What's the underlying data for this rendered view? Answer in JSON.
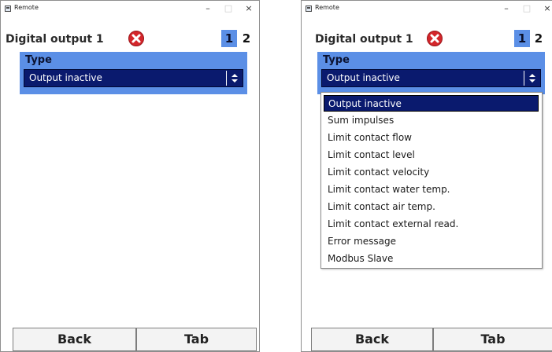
{
  "left": {
    "window_title": "Remote",
    "header": {
      "title": "Digital output 1",
      "tabs": [
        "1",
        "2"
      ]
    },
    "type_panel": {
      "label": "Type",
      "selected_value": "Output inactive"
    },
    "footer": {
      "back": "Back",
      "tab": "Tab"
    }
  },
  "right": {
    "window_title": "Remote",
    "header": {
      "title": "Digital output 1",
      "tabs": [
        "1",
        "2"
      ]
    },
    "type_panel": {
      "label": "Type",
      "selected_value": "Output inactive"
    },
    "dropdown_options": [
      "Output inactive",
      "Sum impulses",
      "Limit contact flow",
      "Limit contact level",
      "Limit contact velocity",
      "Limit contact water temp.",
      "Limit contact air temp.",
      "Limit contact external read.",
      "Error message",
      "Modbus Slave"
    ],
    "footer": {
      "back": "Back",
      "tab": "Tab"
    }
  },
  "window_controls": {
    "minimize": "–",
    "maximize": "□",
    "close": "×"
  },
  "colors": {
    "panel_blue": "#5b8fe6",
    "select_navy": "#0a1a6e",
    "error_red": "#d4262b"
  },
  "icons": {
    "error": "x-circle-icon",
    "select_arrows": "up-down-arrows-icon",
    "app": "window-icon"
  }
}
